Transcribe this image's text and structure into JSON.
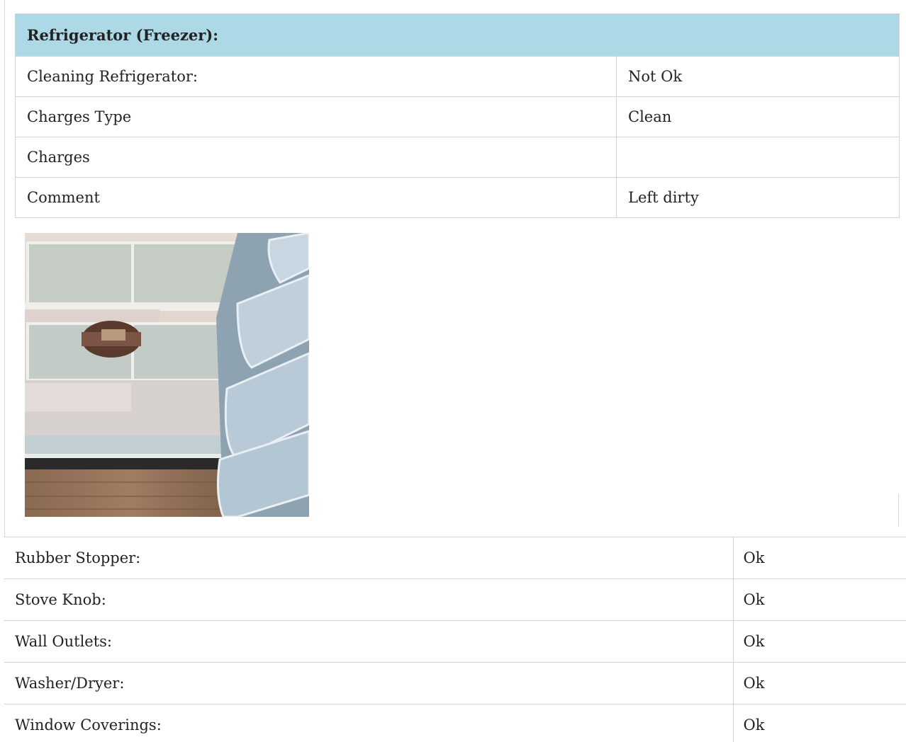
{
  "section": {
    "title": "Refrigerator (Freezer):",
    "title_value": "",
    "rows": [
      {
        "label": "Cleaning Refrigerator:",
        "value": "Not Ok"
      },
      {
        "label": "Charges Type",
        "value": "Clean"
      },
      {
        "label": "Charges",
        "value": ""
      },
      {
        "label": "Comment",
        "value": "Left dirty"
      }
    ],
    "header_color": "#add8e6"
  },
  "items": [
    {
      "label": "Rubber Stopper:",
      "value": "Ok"
    },
    {
      "label": "Stove Knob:",
      "value": "Ok"
    },
    {
      "label": "Wall Outlets:",
      "value": "Ok"
    },
    {
      "label": "Washer/Dryer:",
      "value": "Ok"
    },
    {
      "label": "Window Coverings:",
      "value": "Ok"
    }
  ]
}
